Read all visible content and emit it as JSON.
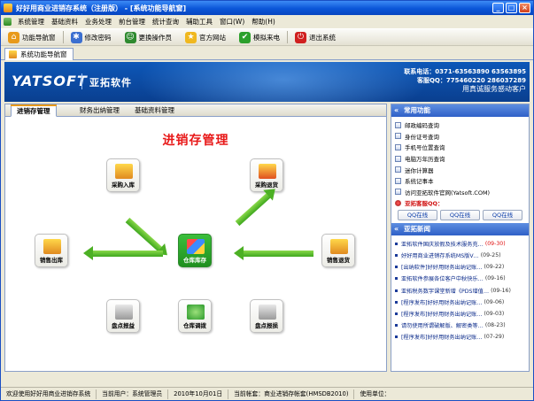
{
  "window": {
    "title": "好好用商业进销存系统（注册版） - [系统功能导航窗]",
    "buttons": [
      "_",
      "□",
      "×"
    ]
  },
  "menu": [
    "系统管理",
    "基础资料",
    "业务处理",
    "前台管理",
    "统计查询",
    "辅助工具",
    "窗口(W)",
    "帮助(H)"
  ],
  "toolbar": [
    {
      "label": "功能导航窗",
      "icon": "home-icon",
      "color": "#e89a1a"
    },
    {
      "label": "修改密码",
      "icon": "key-users-icon",
      "color": "#3b6fd0"
    },
    {
      "label": "更换操作员",
      "icon": "users-icon",
      "color": "#2f8a2f"
    },
    {
      "label": "官方网站",
      "icon": "star-icon",
      "color": "#f0b820"
    },
    {
      "label": "模拟来电",
      "icon": "phone-check-icon",
      "color": "#2ca02c"
    },
    {
      "label": "退出系统",
      "icon": "exit-icon",
      "color": "#d02020"
    }
  ],
  "doc_tab": {
    "label": "系统功能导航窗"
  },
  "banner": {
    "logo": "YATSOFT",
    "company": "亚拓软件",
    "phone_line": "联系电话：0371-63563890  63563895",
    "qq_line": "客服QQ：775460220  286037289",
    "slogan": "用真诚服务感动客户"
  },
  "main": {
    "tabs": [
      "进销存管理",
      "财务出纳管理",
      "基础资料管理"
    ],
    "section_title": "进销存管理",
    "nodes": {
      "purchase_in": "采购入库",
      "purchase_return": "采购退货",
      "sales_out": "销售出库",
      "inventory": "仓库库存",
      "sales_return": "销售退货",
      "inventory_gain": "盘点报益",
      "warehouse_transfer": "仓库调拨",
      "inventory_loss": "盘点报损"
    }
  },
  "side": {
    "common_header": "常用功能",
    "common_items": [
      "邮政编码查询",
      "身份证号查询",
      "手机号位置查询",
      "电脑万年历查询",
      "迷你计算器",
      "系统记事本",
      "访问亚拓软件官网(Yatsoft.COM)"
    ],
    "qq_label": "亚拓客服QQ：",
    "qq_buttons": [
      "QQ在线",
      "QQ在线",
      "QQ在线"
    ],
    "news_header": "亚拓新闻",
    "news": [
      {
        "title": "亚拓软件国庆放假及技术服务充…",
        "date": "(09-30)",
        "highlight": true
      },
      {
        "title": "好好用商业进销存系统MS版V…",
        "date": "(09-25)",
        "highlight": false
      },
      {
        "title": "[出纳软件]好好用财务出纳记账…",
        "date": "(09-22)",
        "highlight": false
      },
      {
        "title": "亚拓软件参展各位客户中秋快乐…",
        "date": "(09-16)",
        "highlight": false
      },
      {
        "title": "亚拓税务数字课堂新增《PDS增值…",
        "date": "(09-16)",
        "highlight": false
      },
      {
        "title": "[程序发布]好好用财务出纳记账…",
        "date": "(09-06)",
        "highlight": false
      },
      {
        "title": "[程序发布]好好用财务出纳记账…",
        "date": "(09-03)",
        "highlight": false
      },
      {
        "title": "请勿使用所谓破解版、解密类等…",
        "date": "(08-23)",
        "highlight": false
      },
      {
        "title": "[程序发布]好好用财务出纳记账…",
        "date": "(07-29)",
        "highlight": false
      }
    ]
  },
  "status": {
    "welcome": "欢迎使用好好用商业进销存系统",
    "user": "当前用户：系统管理员",
    "date": "2010年10月01日",
    "account": "当前帐套：商业进销存帐套(HMSDB2010)",
    "unit": "使用单位："
  }
}
